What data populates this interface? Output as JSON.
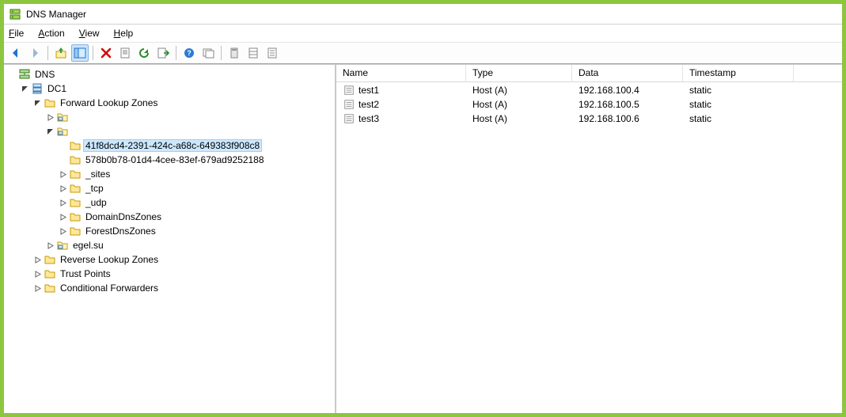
{
  "window": {
    "title": "DNS Manager"
  },
  "menu": {
    "file": "File",
    "action": "Action",
    "view": "View",
    "help": "Help"
  },
  "tree": {
    "root": "DNS",
    "server": "DC1",
    "fwd": "Forward Lookup Zones",
    "guid1": "41f8dcd4-2391-424c-a68c-649383f908c8",
    "guid2": "578b0b78-01d4-4cee-83ef-679ad9252188",
    "sites": "_sites",
    "tcp": "_tcp",
    "udp": "_udp",
    "ddz": "DomainDnsZones",
    "fdz": "ForestDnsZones",
    "egel": "egel.su",
    "rev": "Reverse Lookup Zones",
    "trust": "Trust Points",
    "cond": "Conditional Forwarders"
  },
  "columns": {
    "name": "Name",
    "type": "Type",
    "data": "Data",
    "timestamp": "Timestamp"
  },
  "records": [
    {
      "name": "test1",
      "type": "Host (A)",
      "data": "192.168.100.4",
      "timestamp": "static"
    },
    {
      "name": "test2",
      "type": "Host (A)",
      "data": "192.168.100.5",
      "timestamp": "static"
    },
    {
      "name": "test3",
      "type": "Host (A)",
      "data": "192.168.100.6",
      "timestamp": "static"
    }
  ]
}
